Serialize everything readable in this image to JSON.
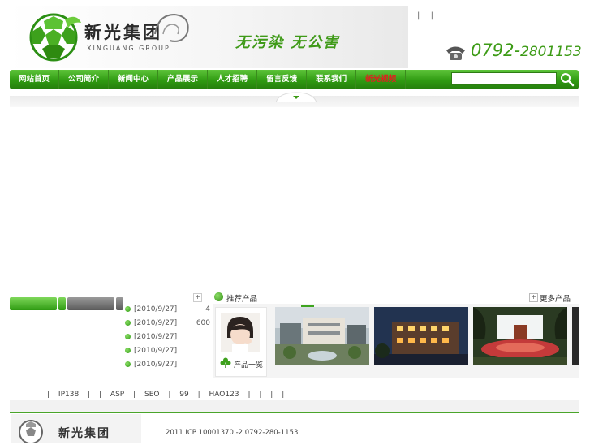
{
  "header": {
    "logo_cn": "新光集团",
    "logo_en": "XINGUANG GROUP",
    "slogan": "无污染  无公害",
    "top_links": [
      "|",
      "|"
    ],
    "phone_prefix": "0792-",
    "phone_number": "2801153"
  },
  "nav": {
    "items": [
      "网站首页",
      "公司简介",
      "新闻中心",
      "产品展示",
      "人才招聘",
      "留言反馈",
      "联系我们",
      "新光视频"
    ],
    "search_placeholder": ""
  },
  "news": {
    "plus": "+",
    "items": [
      {
        "date": "[2010/9/27]",
        "title": "4",
        "more": "..."
      },
      {
        "date": "[2010/9/27]",
        "title": "600",
        "more": "..."
      },
      {
        "date": "[2010/9/27]",
        "title": "",
        "more": "..."
      },
      {
        "date": "[2010/9/27]",
        "title": "",
        "more": "..."
      },
      {
        "date": "[2010/9/27]",
        "title": "",
        "more": "..."
      }
    ]
  },
  "products": {
    "title": "推荐产品",
    "more_plus": "+",
    "more_label": "更多产品",
    "catalog_label": "产品一览"
  },
  "footer": {
    "links": [
      "|",
      "IP138",
      "|",
      "|",
      "ASP",
      "|",
      "SEO",
      "|",
      "99",
      "|",
      "HAO123",
      "|",
      "|",
      "|",
      "|"
    ],
    "logo_cn": "新光集团",
    "copyright": "2011      ICP 10001370 -2    0792-280-1153"
  },
  "colors": {
    "brand_green": "#3d9b16",
    "nav_dark": "#257d0c",
    "highlight_red": "#e02020"
  }
}
